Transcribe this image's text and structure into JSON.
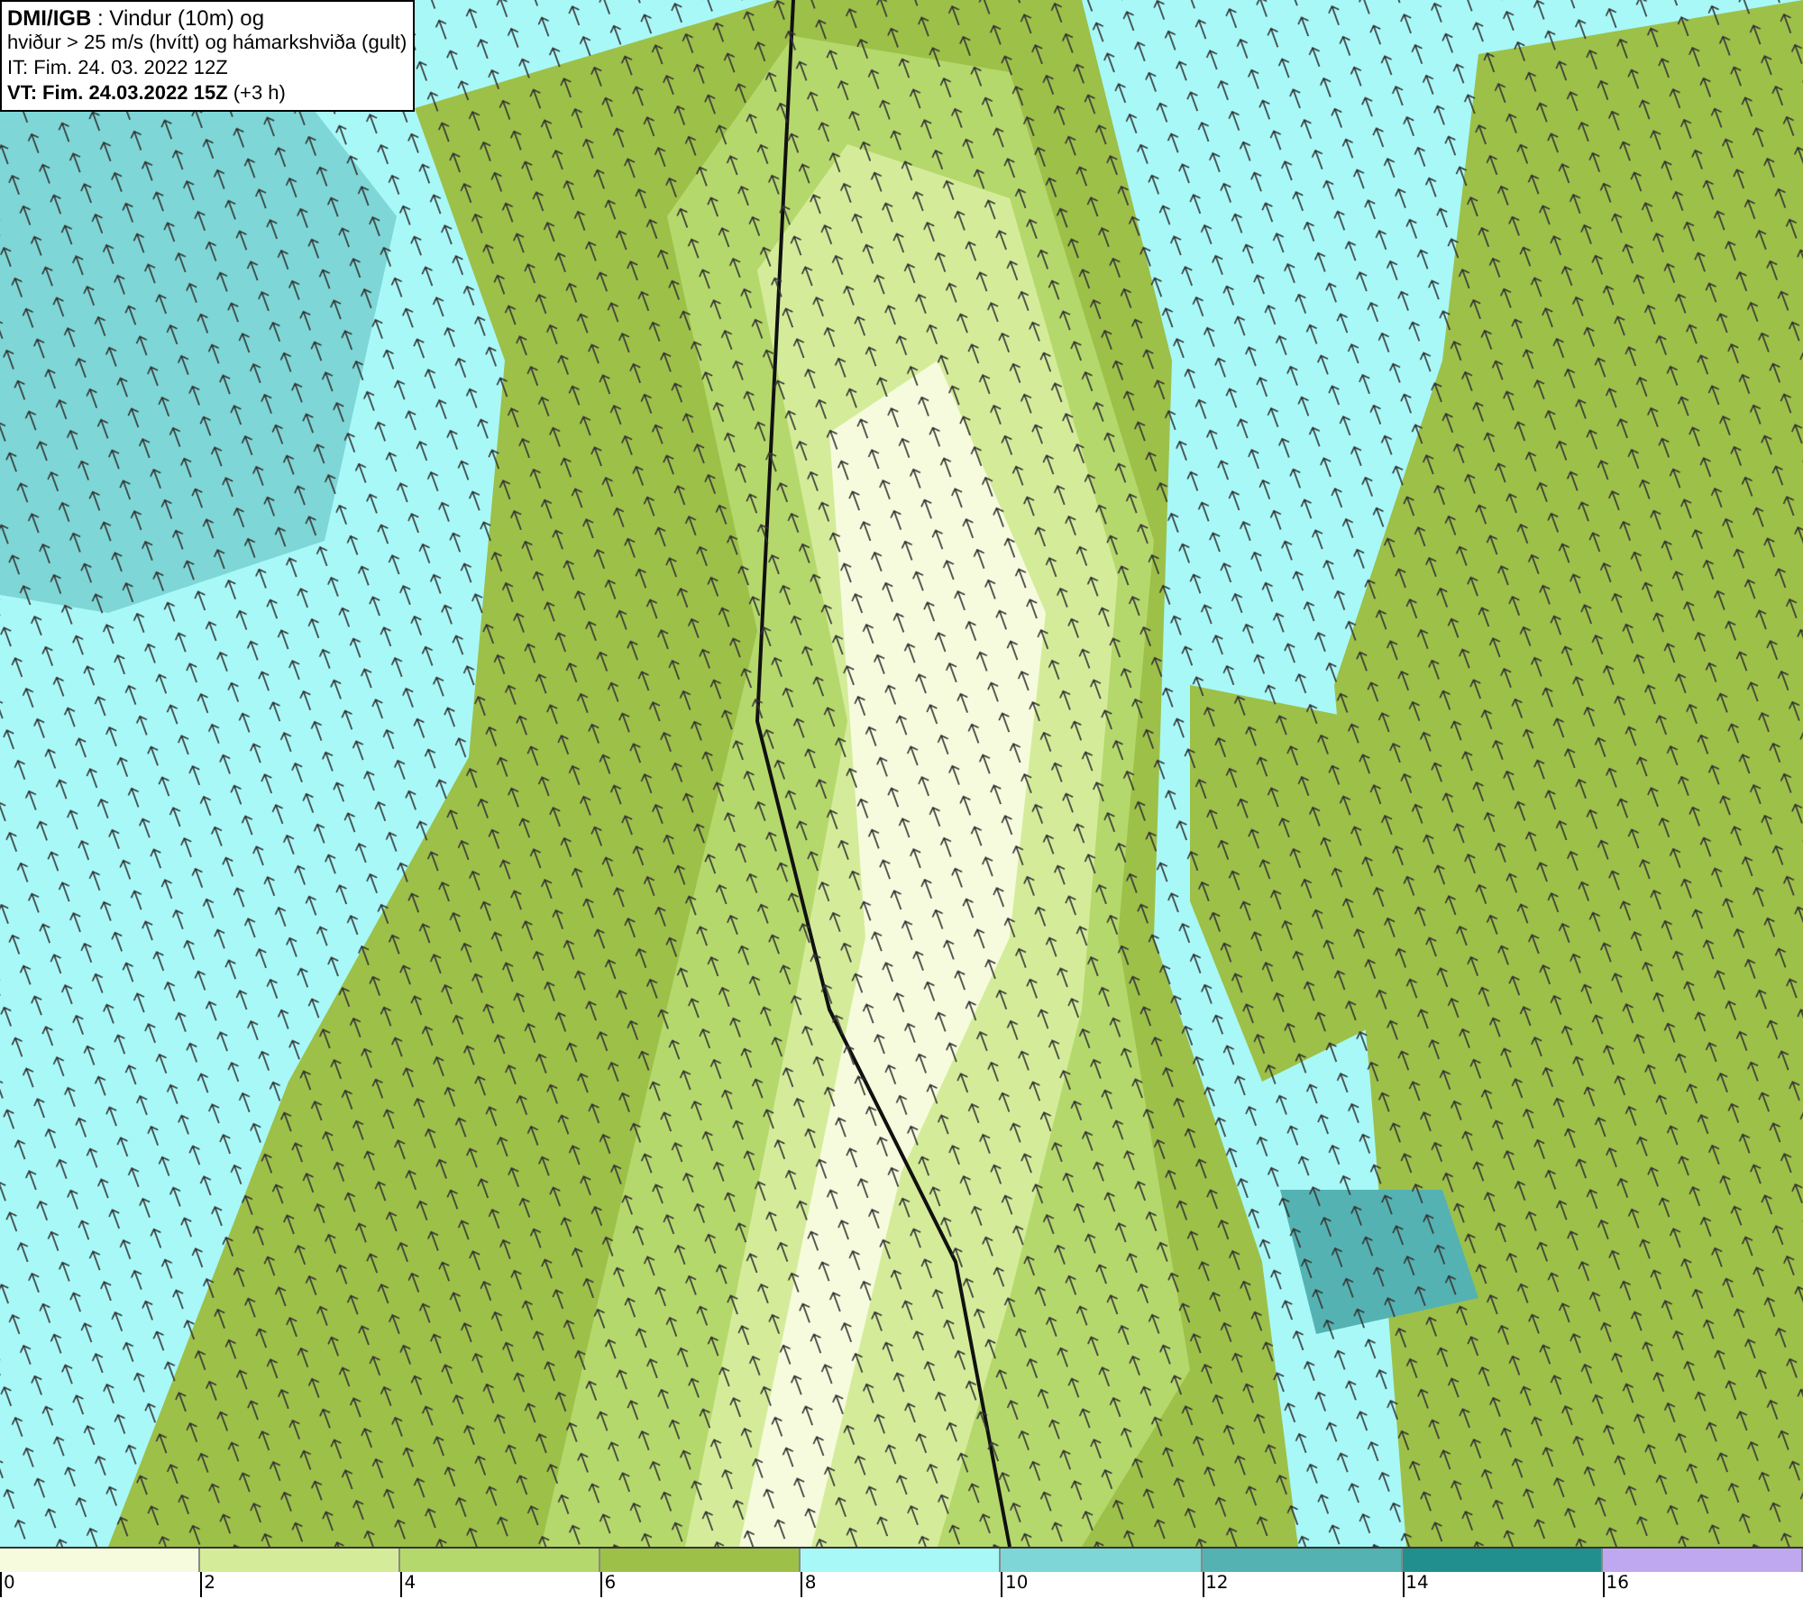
{
  "header": {
    "lines": [
      "**DMI/IGB** : Vindur (10m) og",
      "hviður > 25 m/s (hvítt) og hámarkshviða (gult)",
      "IT: Fim. 24. 03. 2022 12Z",
      "**VT: Fim. 24.03.2022 15Z** (+3 h)"
    ]
  },
  "legend": [
    {
      "label": "0",
      "color": "#f5fbdc"
    },
    {
      "label": "2",
      "color": "#d4ec9a"
    },
    {
      "label": "4",
      "color": "#b5d86c"
    },
    {
      "label": "6",
      "color": "#9dc049"
    },
    {
      "label": "8",
      "color": "#a8f8f8"
    },
    {
      "label": "10",
      "color": "#7ed6d6"
    },
    {
      "label": "12",
      "color": "#55b2b2"
    },
    {
      "label": "14",
      "color": "#228f8f"
    },
    {
      "label": "16",
      "color": "#c0a8f0"
    }
  ]
}
